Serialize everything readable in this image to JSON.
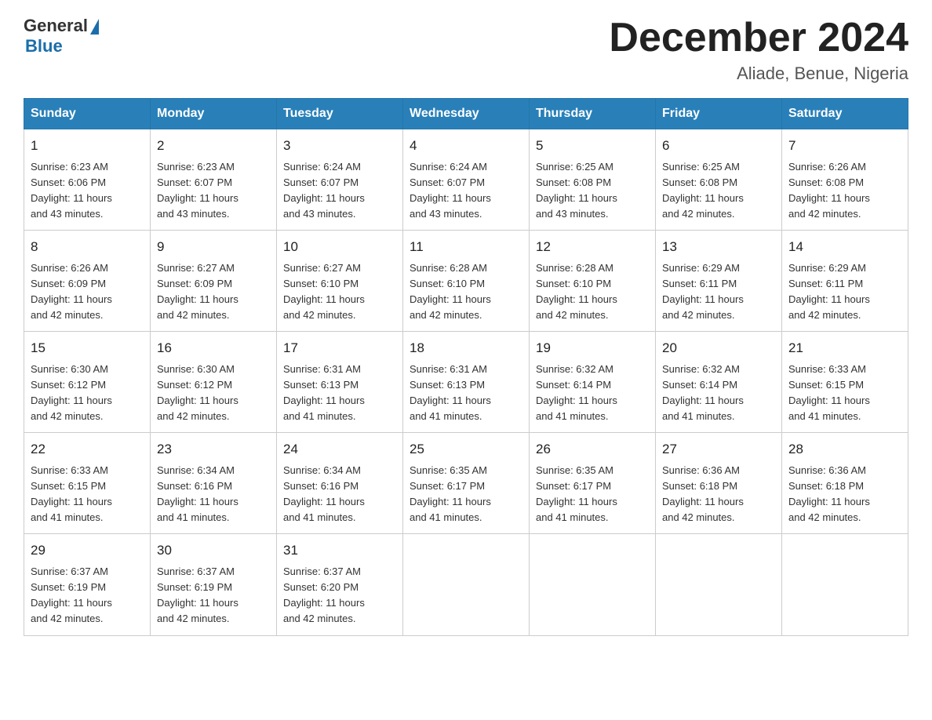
{
  "logo": {
    "general": "General",
    "triangle": "▶",
    "blue": "Blue"
  },
  "header": {
    "month": "December 2024",
    "location": "Aliade, Benue, Nigeria"
  },
  "weekdays": [
    "Sunday",
    "Monday",
    "Tuesday",
    "Wednesday",
    "Thursday",
    "Friday",
    "Saturday"
  ],
  "weeks": [
    [
      {
        "day": "1",
        "sunrise": "6:23 AM",
        "sunset": "6:06 PM",
        "daylight": "11 hours and 43 minutes."
      },
      {
        "day": "2",
        "sunrise": "6:23 AM",
        "sunset": "6:07 PM",
        "daylight": "11 hours and 43 minutes."
      },
      {
        "day": "3",
        "sunrise": "6:24 AM",
        "sunset": "6:07 PM",
        "daylight": "11 hours and 43 minutes."
      },
      {
        "day": "4",
        "sunrise": "6:24 AM",
        "sunset": "6:07 PM",
        "daylight": "11 hours and 43 minutes."
      },
      {
        "day": "5",
        "sunrise": "6:25 AM",
        "sunset": "6:08 PM",
        "daylight": "11 hours and 43 minutes."
      },
      {
        "day": "6",
        "sunrise": "6:25 AM",
        "sunset": "6:08 PM",
        "daylight": "11 hours and 42 minutes."
      },
      {
        "day": "7",
        "sunrise": "6:26 AM",
        "sunset": "6:08 PM",
        "daylight": "11 hours and 42 minutes."
      }
    ],
    [
      {
        "day": "8",
        "sunrise": "6:26 AM",
        "sunset": "6:09 PM",
        "daylight": "11 hours and 42 minutes."
      },
      {
        "day": "9",
        "sunrise": "6:27 AM",
        "sunset": "6:09 PM",
        "daylight": "11 hours and 42 minutes."
      },
      {
        "day": "10",
        "sunrise": "6:27 AM",
        "sunset": "6:10 PM",
        "daylight": "11 hours and 42 minutes."
      },
      {
        "day": "11",
        "sunrise": "6:28 AM",
        "sunset": "6:10 PM",
        "daylight": "11 hours and 42 minutes."
      },
      {
        "day": "12",
        "sunrise": "6:28 AM",
        "sunset": "6:10 PM",
        "daylight": "11 hours and 42 minutes."
      },
      {
        "day": "13",
        "sunrise": "6:29 AM",
        "sunset": "6:11 PM",
        "daylight": "11 hours and 42 minutes."
      },
      {
        "day": "14",
        "sunrise": "6:29 AM",
        "sunset": "6:11 PM",
        "daylight": "11 hours and 42 minutes."
      }
    ],
    [
      {
        "day": "15",
        "sunrise": "6:30 AM",
        "sunset": "6:12 PM",
        "daylight": "11 hours and 42 minutes."
      },
      {
        "day": "16",
        "sunrise": "6:30 AM",
        "sunset": "6:12 PM",
        "daylight": "11 hours and 42 minutes."
      },
      {
        "day": "17",
        "sunrise": "6:31 AM",
        "sunset": "6:13 PM",
        "daylight": "11 hours and 41 minutes."
      },
      {
        "day": "18",
        "sunrise": "6:31 AM",
        "sunset": "6:13 PM",
        "daylight": "11 hours and 41 minutes."
      },
      {
        "day": "19",
        "sunrise": "6:32 AM",
        "sunset": "6:14 PM",
        "daylight": "11 hours and 41 minutes."
      },
      {
        "day": "20",
        "sunrise": "6:32 AM",
        "sunset": "6:14 PM",
        "daylight": "11 hours and 41 minutes."
      },
      {
        "day": "21",
        "sunrise": "6:33 AM",
        "sunset": "6:15 PM",
        "daylight": "11 hours and 41 minutes."
      }
    ],
    [
      {
        "day": "22",
        "sunrise": "6:33 AM",
        "sunset": "6:15 PM",
        "daylight": "11 hours and 41 minutes."
      },
      {
        "day": "23",
        "sunrise": "6:34 AM",
        "sunset": "6:16 PM",
        "daylight": "11 hours and 41 minutes."
      },
      {
        "day": "24",
        "sunrise": "6:34 AM",
        "sunset": "6:16 PM",
        "daylight": "11 hours and 41 minutes."
      },
      {
        "day": "25",
        "sunrise": "6:35 AM",
        "sunset": "6:17 PM",
        "daylight": "11 hours and 41 minutes."
      },
      {
        "day": "26",
        "sunrise": "6:35 AM",
        "sunset": "6:17 PM",
        "daylight": "11 hours and 41 minutes."
      },
      {
        "day": "27",
        "sunrise": "6:36 AM",
        "sunset": "6:18 PM",
        "daylight": "11 hours and 42 minutes."
      },
      {
        "day": "28",
        "sunrise": "6:36 AM",
        "sunset": "6:18 PM",
        "daylight": "11 hours and 42 minutes."
      }
    ],
    [
      {
        "day": "29",
        "sunrise": "6:37 AM",
        "sunset": "6:19 PM",
        "daylight": "11 hours and 42 minutes."
      },
      {
        "day": "30",
        "sunrise": "6:37 AM",
        "sunset": "6:19 PM",
        "daylight": "11 hours and 42 minutes."
      },
      {
        "day": "31",
        "sunrise": "6:37 AM",
        "sunset": "6:20 PM",
        "daylight": "11 hours and 42 minutes."
      },
      null,
      null,
      null,
      null
    ]
  ],
  "labels": {
    "sunrise": "Sunrise:",
    "sunset": "Sunset:",
    "daylight": "Daylight:"
  }
}
